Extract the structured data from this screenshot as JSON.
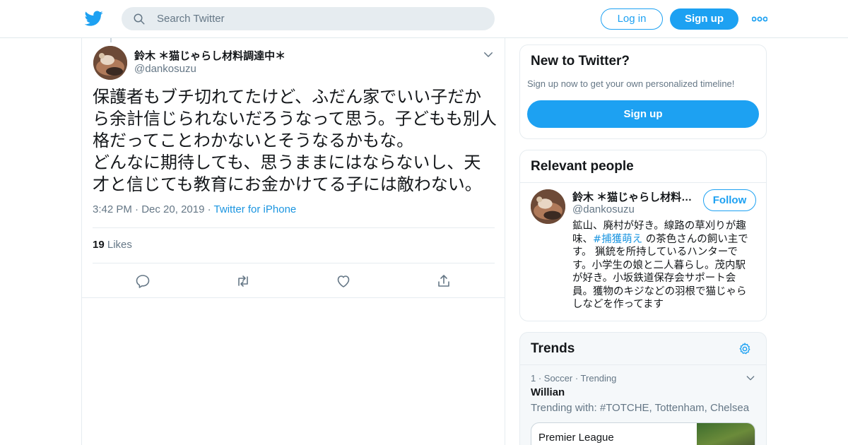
{
  "header": {
    "search_placeholder": "Search Twitter",
    "login_label": "Log in",
    "signup_label": "Sign up"
  },
  "tweet": {
    "author_name": "鈴木 ＊猫じゃらし材料調達中＊",
    "author_handle": "@dankosuzu",
    "text_lines": [
      "保護者もブチ切れてたけど、ふだん家でいい子だか",
      "ら余計信じられないだろうなって思う。子どもも別人",
      "格だってことわかないとそうなるかもな。",
      "どんなに期待しても、思うままにはならないし、天",
      "才と信じても教育にお金かけてる子には敵わない。"
    ],
    "time": "3:42 PM",
    "date": "Dec 20, 2019",
    "source": "Twitter for iPhone",
    "likes_count": "19",
    "likes_label": "Likes"
  },
  "new_to_twitter": {
    "title": "New to Twitter?",
    "subtitle": "Sign up now to get your own personalized timeline!",
    "button": "Sign up"
  },
  "relevant_people": {
    "title": "Relevant people",
    "name": "鈴木 ＊猫じゃらし材料調達中＊",
    "handle": "@dankosuzu",
    "follow_label": "Follow",
    "bio": {
      "line1": "鉱山、廃村が好き。線路の草刈りが趣",
      "line2_pre": "味、",
      "hashtag": "#捕獲萌え",
      "line2_post": " の茶色さんの飼い主で",
      "line3": "す。 猟銃を所持しているハンターで",
      "line4": "す。小学生の娘と二人暮らし。茂内駅",
      "line5": "が好き。小坂鉄道保存会サポート会",
      "line6": "員。獲物のキジなどの羽根で猫じゃら",
      "line7": "しなどを作ってます"
    }
  },
  "trends": {
    "title": "Trends",
    "item": {
      "context": "1 · Soccer · Trending",
      "name": "Willian",
      "with": "Trending with: #TOTCHE, Tottenham, Chelsea"
    },
    "card_label": "Premier League"
  },
  "colors": {
    "brand": "#1da1f2",
    "link": "#1b95e0",
    "secondary_text": "#657786"
  }
}
